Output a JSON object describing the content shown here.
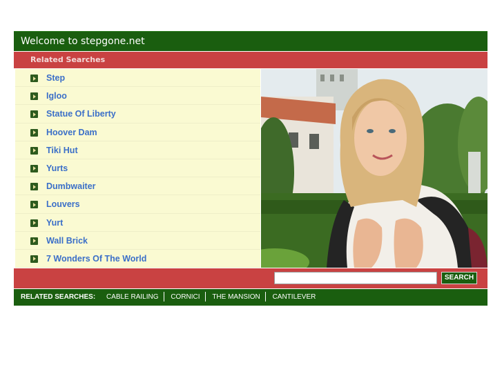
{
  "header": {
    "title": "Welcome to stepgone.net"
  },
  "related": {
    "title": "Related Searches"
  },
  "links": [
    {
      "label": "Step"
    },
    {
      "label": "Igloo"
    },
    {
      "label": "Statue Of Liberty"
    },
    {
      "label": "Hoover Dam"
    },
    {
      "label": "Tiki Hut"
    },
    {
      "label": "Yurts"
    },
    {
      "label": "Dumbwaiter"
    },
    {
      "label": "Louvers"
    },
    {
      "label": "Yurt"
    },
    {
      "label": "Wall Brick"
    },
    {
      "label": "7 Wonders Of The World"
    }
  ],
  "search": {
    "value": "",
    "button_label": "SEARCH"
  },
  "footer": {
    "label": "RELATED SEARCHES:",
    "links": [
      "CABLE RAILING",
      "CORNICI",
      "THE MANSION",
      "CANTILEVER"
    ]
  },
  "colors": {
    "green": "#1a5e0f",
    "red": "#c94242",
    "cream": "#fafad2",
    "link": "#3b6fc8"
  },
  "icons": {
    "bullet": "green-arrow-bullet-icon"
  }
}
